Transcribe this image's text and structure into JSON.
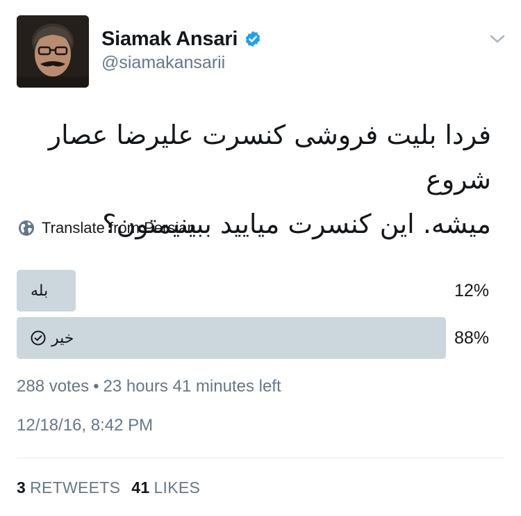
{
  "header": {
    "display_name": "Siamak Ansari",
    "handle": "@siamakansarii",
    "verified": true
  },
  "tweet": {
    "text_line1": "فردا بلیت فروشی کنسرت علیرضا عصار شروع",
    "text_line2": "میشه. این کنسرت میایید ببینیمتون؟"
  },
  "translate": {
    "label": "Translate from Persian",
    "icon": "globe-icon"
  },
  "poll": {
    "options": [
      {
        "label": "بله",
        "percent_text": "12%",
        "percent": 12,
        "selected": false
      },
      {
        "label": "خیر",
        "percent_text": "88%",
        "percent": 88,
        "selected": true
      }
    ],
    "votes": "288 votes",
    "separator": "•",
    "time_left": "23 hours 41 minutes left"
  },
  "timestamp": "12/18/16, 8:42 PM",
  "stats": {
    "retweets_count": "3",
    "retweets_label": "RETWEETS",
    "likes_count": "41",
    "likes_label": "LIKES"
  },
  "colors": {
    "text": "#14171a",
    "secondary": "#657786",
    "poll_bar": "#ccd6dd",
    "verified": "#1da1f2",
    "divider": "#e1e8ed"
  }
}
